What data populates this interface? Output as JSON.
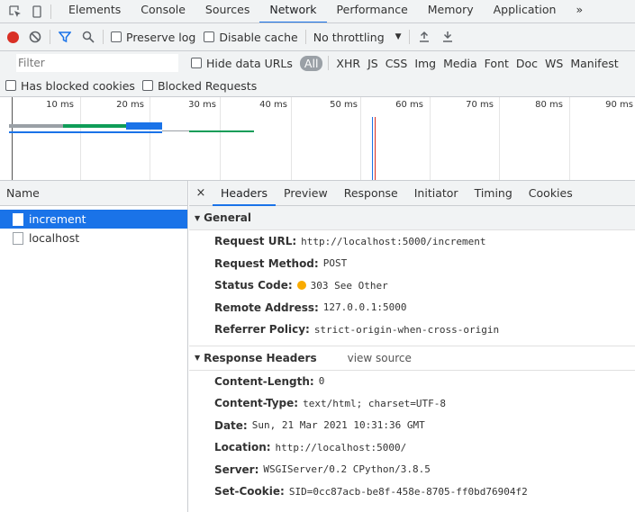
{
  "devtools": {
    "tabs": [
      {
        "label": "Elements"
      },
      {
        "label": "Console"
      },
      {
        "label": "Sources"
      },
      {
        "label": "Network",
        "active": true
      },
      {
        "label": "Performance"
      },
      {
        "label": "Memory"
      },
      {
        "label": "Application"
      }
    ],
    "more_tabs": "»"
  },
  "toolbar": {
    "preserve_log": "Preserve log",
    "disable_cache": "Disable cache",
    "throttling": "No throttling"
  },
  "filter": {
    "placeholder": "Filter",
    "hide_data_urls": "Hide data URLs",
    "types": [
      "All",
      "XHR",
      "JS",
      "CSS",
      "Img",
      "Media",
      "Font",
      "Doc",
      "WS",
      "Manifest"
    ],
    "has_blocked_cookies": "Has blocked cookies",
    "blocked_requests": "Blocked Requests"
  },
  "overview": {
    "tick_labels": [
      "10 ms",
      "20 ms",
      "30 ms",
      "40 ms",
      "50 ms",
      "60 ms",
      "70 ms",
      "80 ms",
      "90 ms"
    ]
  },
  "list": {
    "header": "Name",
    "requests": [
      {
        "name": "increment",
        "selected": true
      },
      {
        "name": "localhost",
        "selected": false
      }
    ]
  },
  "detail": {
    "close": "×",
    "tabs": [
      "Headers",
      "Preview",
      "Response",
      "Initiator",
      "Timing",
      "Cookies"
    ],
    "general": {
      "title": "General",
      "rows": [
        {
          "key": "Request URL:",
          "value": "http://localhost:5000/increment"
        },
        {
          "key": "Request Method:",
          "value": "POST"
        },
        {
          "key": "Status Code:",
          "value": "303 See Other"
        },
        {
          "key": "Remote Address:",
          "value": "127.0.0.1:5000"
        },
        {
          "key": "Referrer Policy:",
          "value": "strict-origin-when-cross-origin"
        }
      ]
    },
    "response_headers": {
      "title": "Response Headers",
      "view_source": "view source",
      "rows": [
        {
          "key": "Content-Length:",
          "value": "0"
        },
        {
          "key": "Content-Type:",
          "value": "text/html; charset=UTF-8"
        },
        {
          "key": "Date:",
          "value": "Sun, 21 Mar 2021 10:31:36 GMT"
        },
        {
          "key": "Location:",
          "value": "http://localhost:5000/"
        },
        {
          "key": "Server:",
          "value": "WSGIServer/0.2 CPython/3.8.5"
        },
        {
          "key": "Set-Cookie:",
          "value": "SID=0cc87acb-be8f-458e-8705-ff0bd76904f2"
        }
      ]
    }
  },
  "colors": {
    "accent": "#1a73e8",
    "record": "#d93025",
    "status_redirect": "#f9ab00"
  }
}
